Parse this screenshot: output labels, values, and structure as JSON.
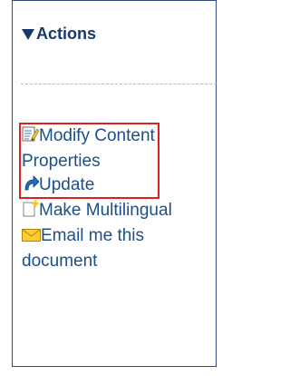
{
  "panel": {
    "title": "Actions"
  },
  "actions": [
    {
      "label": "Modify Content Properties",
      "icon": "document-edit-icon"
    },
    {
      "label": "Update",
      "icon": "update-arrow-icon"
    },
    {
      "label": "Make Multilingual",
      "icon": "new-document-icon"
    },
    {
      "label": "Email me this document",
      "icon": "email-icon"
    }
  ],
  "colors": {
    "link": "#1b4f8a",
    "title": "#17396a",
    "highlight": "#e02020",
    "border": "#2e4f7a"
  }
}
